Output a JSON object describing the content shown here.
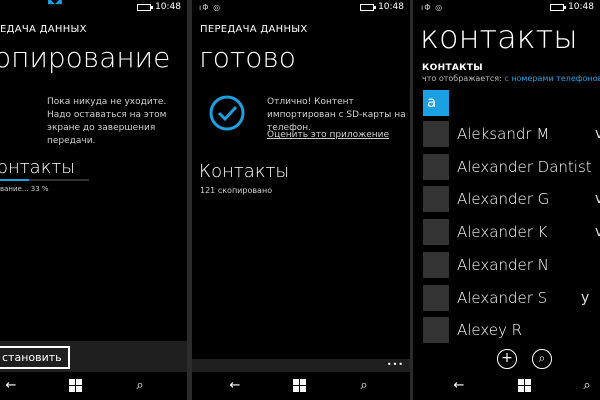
{
  "panel1": {
    "header": "ЕДАЧА ДАННЫХ",
    "title": "опирование",
    "message": "Пока никуда не уходите. Надо оставаться на этом экране до завершения передачи.",
    "section": "онтакты",
    "progress_text": "вание... 33 %",
    "progress": 0.33,
    "stop_button": "становить",
    "time": "10:48"
  },
  "panel2": {
    "header": "ПЕРЕДАЧА ДАННЫХ",
    "title": "готово",
    "message": "Отлично! Контент импортирован с SD-карты на телефон.",
    "rate_link": "Оценить это приложение",
    "section": "Контакты",
    "count_text": "121 скопировано",
    "time": "10:48",
    "more": "•••"
  },
  "panel3": {
    "title": "контакты",
    "subheader": "КОНТАКТЫ",
    "filter_label": "что отображается:",
    "filter_value": "с номерами телефонов",
    "letter": "a",
    "time": "10:48",
    "contacts": [
      {
        "name": "Aleksandr M",
        "cut": "v"
      },
      {
        "name": "Alexander Dantist",
        "cut": ""
      },
      {
        "name": "Alexander G",
        "cut": "v"
      },
      {
        "name": "Alexander K",
        "cut": "v"
      },
      {
        "name": "Alexander N",
        "cut": ""
      },
      {
        "name": "Alexander S",
        "cut": "y"
      },
      {
        "name": "Alexey R",
        "cut": ""
      }
    ]
  },
  "colors": {
    "accent": "#1ba1e2",
    "background": "#000000",
    "tile": "#333333"
  },
  "icons": {
    "back": "back-arrow-icon",
    "home": "windows-logo-icon",
    "search": "search-icon",
    "check": "checkmark-circle-icon",
    "add": "add-icon"
  }
}
